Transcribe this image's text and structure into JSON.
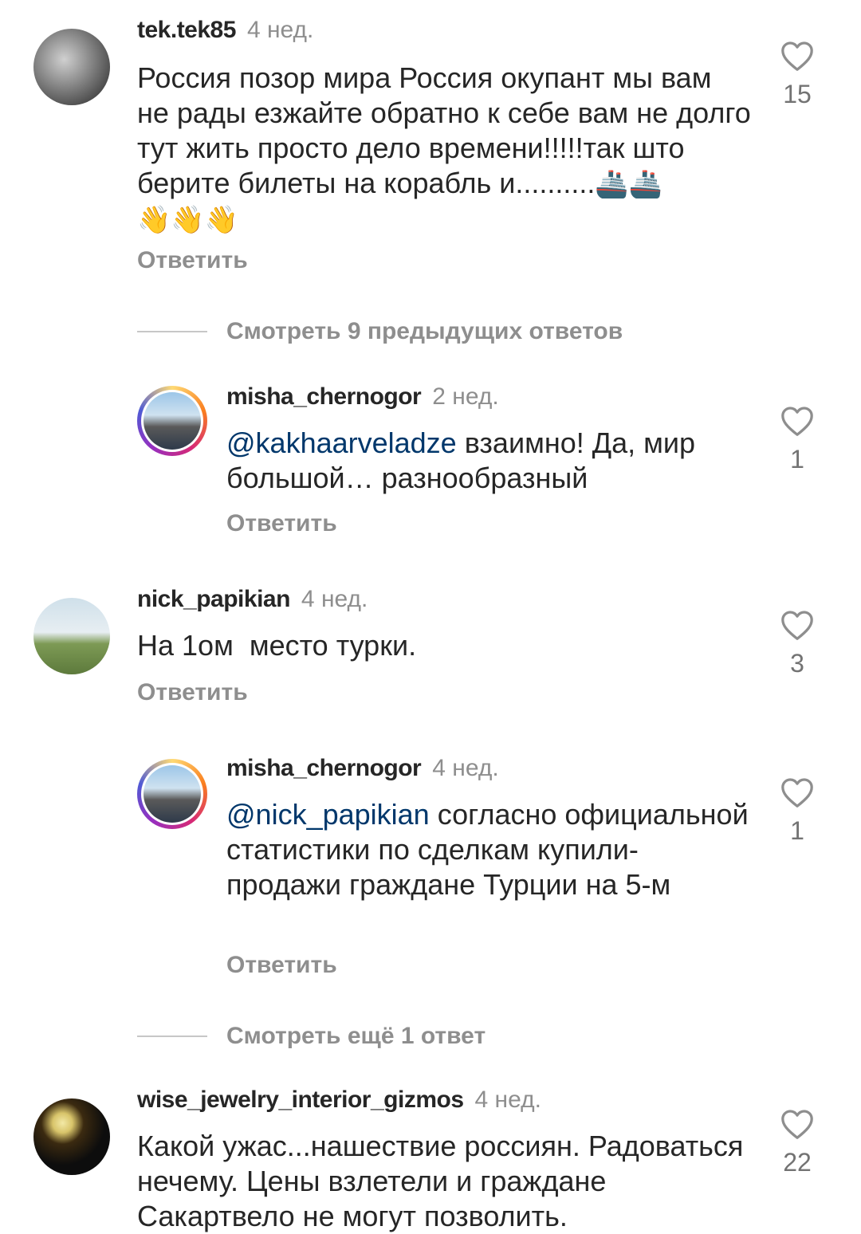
{
  "comments": [
    {
      "username": "tek.tek85",
      "time": "4 нед.",
      "text": "Россия позор мира Россия окупант мы вам не рады езжайте обратно к себе вам не долго тут жить просто дело времени!!!!!так што берите билеты на корабль и..........",
      "emoji_line1": "🚢🚢",
      "emoji_line2": "👋👋👋",
      "reply": "Ответить",
      "likes": "15"
    },
    {
      "username": "misha_chernogor",
      "time": "2 нед.",
      "mention": "@kakhaarveladze",
      "text": " взаимно! Да, мир большой… разнообразный",
      "reply": "Ответить",
      "likes": "1"
    },
    {
      "username": "nick_papikian",
      "time": "4 нед.",
      "text": "На 1ом  место турки.",
      "reply": "Ответить",
      "likes": "3"
    },
    {
      "username": "misha_chernogor",
      "time": "4 нед.",
      "mention": "@nick_papikian",
      "text": " согласно официальной статистики по сделкам купили-продажи граждане Турции на 5-м",
      "reply": "Ответить",
      "likes": "1"
    },
    {
      "username": "wise_jewelry_interior_gizmos",
      "time": "4 нед.",
      "text": "Какой ужас...нашествие россиян. Радоваться нечему. Цены взлетели и граждане Сакартвело не могут позволить.",
      "likes": "22"
    }
  ],
  "view_replies": [
    {
      "label": "Смотреть 9 предыдущих ответов"
    },
    {
      "label": "Смотреть ещё 1 ответ"
    }
  ],
  "icons": {
    "like": "heart-outline-icon"
  },
  "colors": {
    "mention": "#00376b",
    "muted": "#8e8e8e",
    "ring_gradient": "#d62976"
  }
}
